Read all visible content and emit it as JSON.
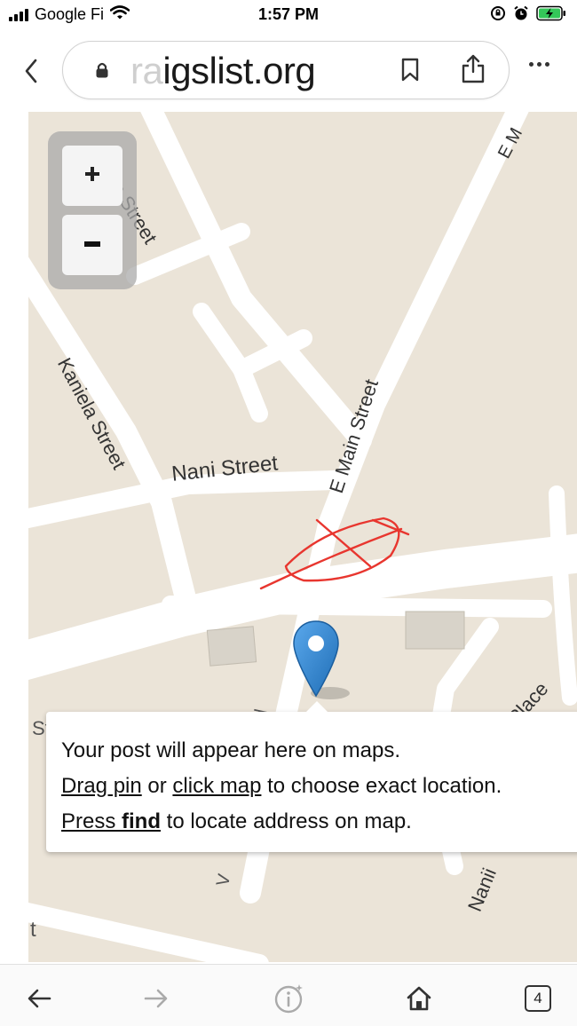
{
  "status_bar": {
    "carrier": "Google Fi",
    "time": "1:57 PM",
    "icons": [
      "signal-icon",
      "wifi-icon",
      "orientation-lock-icon",
      "alarm-icon",
      "battery-charging-icon"
    ],
    "battery_color": "#34c759"
  },
  "browser": {
    "url_faded": "ra",
    "url_text": "igslist.org",
    "icons": [
      "back-chevron-icon",
      "lock-icon",
      "bookmark-icon",
      "share-icon",
      "more-icon"
    ]
  },
  "map": {
    "street_labels": {
      "mission": "ion Street",
      "e_main_top": "E M",
      "kaniela": "Kaniela Street",
      "nani": "Nani Street",
      "e_main": "E Main Street",
      "waiiluna": "Waiiluna Place",
      "nanii": "Nanii",
      "street_left": "Street",
      "vis_a": "V",
      "vis_b": "d",
      "dri": "Dr",
      "t_edge": "t"
    },
    "zoom_in_icon": "plus-icon",
    "zoom_out_icon": "minus-icon",
    "pin_icon": "map-pin-icon",
    "pin_color": "#2f86d6",
    "scribble_color": "#e8362f"
  },
  "tooltip": {
    "line1": "Your post will appear here on maps.",
    "drag_pin": "Drag pin",
    "or_text": " or ",
    "click_map": "click map",
    "to_choose": " to choose exact location.",
    "press": "Press ",
    "find": "find",
    "to_locate": " to locate address on map."
  },
  "bottom_bar": {
    "tabs_count": "4",
    "icons": [
      "back-arrow-icon",
      "forward-arrow-icon",
      "info-icon",
      "home-icon",
      "tabs-icon"
    ]
  }
}
